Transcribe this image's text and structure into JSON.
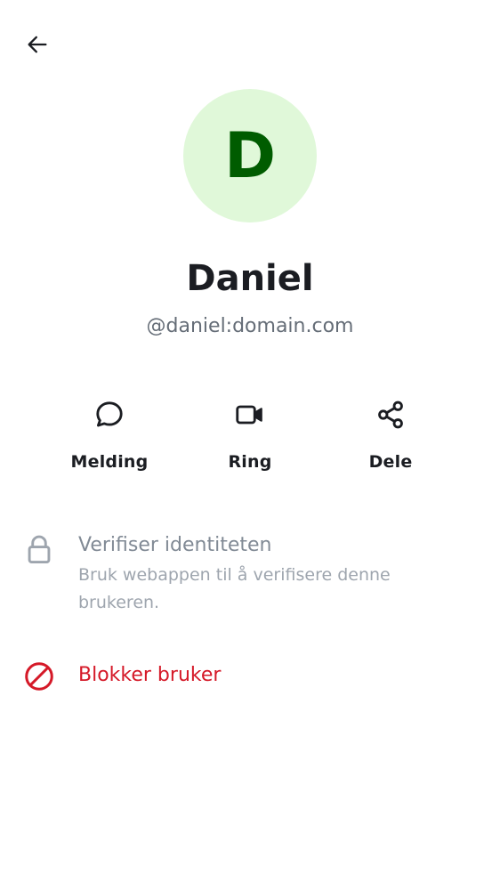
{
  "header": {
    "back_icon": "arrow-left-icon"
  },
  "profile": {
    "avatar_letter": "D",
    "avatar_bg": "#e0f8d9",
    "avatar_fg": "#005c00",
    "display_name": "Daniel",
    "user_id": "@daniel:domain.com"
  },
  "actions": [
    {
      "label": "Melding",
      "icon": "chat-bubble-icon"
    },
    {
      "label": "Ring",
      "icon": "video-camera-icon"
    },
    {
      "label": "Dele",
      "icon": "share-icon"
    }
  ],
  "verify": {
    "icon": "lock-icon",
    "title": "Verifiser identiteten",
    "description": "Bruk webappen til å verifisere denne brukeren."
  },
  "block": {
    "icon": "block-icon",
    "label": "Blokker bruker",
    "color": "#d51928"
  }
}
